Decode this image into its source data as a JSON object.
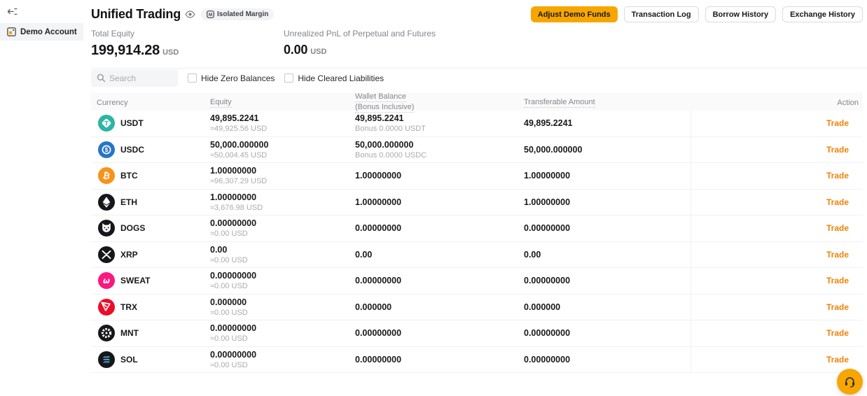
{
  "colors": {
    "brand_orange": "#f7a600",
    "trade_link": "#ee8208",
    "annotation_red": "#f5222d"
  },
  "sidebar": {
    "collapse_icon": "collapse-sidebar-icon",
    "items": [
      {
        "label": "Demo Account",
        "icon": "demo-account-icon",
        "selected": true
      }
    ]
  },
  "header": {
    "title": "Unified Trading",
    "title_icon": "eye-icon",
    "badge": {
      "icon": "margin-mode-icon",
      "label": "Isolated Margin"
    },
    "buttons": {
      "primary": {
        "label": "Adjust Demo Funds",
        "annotated": true
      },
      "secondary": [
        "Transaction Log",
        "Borrow History",
        "Exchange History"
      ]
    }
  },
  "stats": [
    {
      "label": "Total Equity",
      "value": "199,914.28",
      "unit": "USD"
    },
    {
      "label": "Unrealized PnL of Perpetual and Futures",
      "value": "0.00",
      "unit": "USD"
    }
  ],
  "filters": {
    "search_placeholder": "Search",
    "checkboxes": [
      {
        "label": "Hide Zero Balances",
        "checked": false
      },
      {
        "label": "Hide Cleared Liabilities",
        "checked": false
      }
    ]
  },
  "table": {
    "columns": [
      {
        "label": "Currency",
        "underlined": false
      },
      {
        "label": "Equity",
        "underlined": true
      },
      {
        "label": "Wallet Balance",
        "sublabel": "(Bonus Inclusive)",
        "underlined": true
      },
      {
        "label": "Transferable Amount",
        "underlined": true
      },
      {
        "label": "Action",
        "underlined": false
      }
    ],
    "trade_label": "Trade",
    "rows": [
      {
        "symbol": "USDT",
        "icon": "usdt-icon",
        "icon_bg": "#2ab5a5",
        "equity": "49,895.2241",
        "equity_usd": "≈49,925.56 USD",
        "wallet": "49,895.2241",
        "wallet_bonus": "Bonus 0.0000 USDT",
        "transferable": "49,895.2241"
      },
      {
        "symbol": "USDC",
        "icon": "usdc-icon",
        "icon_bg": "#2775ca",
        "equity": "50,000.000000",
        "equity_usd": "≈50,004.45 USD",
        "wallet": "50,000.000000",
        "wallet_bonus": "Bonus 0.0000 USDC",
        "transferable": "50,000.000000"
      },
      {
        "symbol": "BTC",
        "icon": "btc-icon",
        "icon_bg": "#f7931a",
        "equity": "1.00000000",
        "equity_usd": "≈96,307.29 USD",
        "wallet": "1.00000000",
        "transferable": "1.00000000"
      },
      {
        "symbol": "ETH",
        "icon": "eth-icon",
        "icon_bg": "#16171a",
        "equity": "1.00000000",
        "equity_usd": "≈3,676.98 USD",
        "wallet": "1.00000000",
        "transferable": "1.00000000"
      },
      {
        "symbol": "DOGS",
        "icon": "dogs-icon",
        "icon_bg": "#16171a",
        "equity": "0.00000000",
        "equity_usd": "≈0.00 USD",
        "wallet": "0.00000000",
        "transferable": "0.00000000"
      },
      {
        "symbol": "XRP",
        "icon": "xrp-icon",
        "icon_bg": "#16171a",
        "equity": "0.00",
        "equity_usd": "≈0.00 USD",
        "wallet": "0.00",
        "transferable": "0.00"
      },
      {
        "symbol": "SWEAT",
        "icon": "sweat-icon",
        "icon_bg": "#f9197f",
        "equity": "0.00000000",
        "equity_usd": "≈0.00 USD",
        "wallet": "0.00000000",
        "transferable": "0.00000000"
      },
      {
        "symbol": "TRX",
        "icon": "trx-icon",
        "icon_bg": "#eb0c27",
        "equity": "0.000000",
        "equity_usd": "≈0.00 USD",
        "wallet": "0.000000",
        "transferable": "0.000000"
      },
      {
        "symbol": "MNT",
        "icon": "mnt-icon",
        "icon_bg": "#16171a",
        "equity": "0.00000000",
        "equity_usd": "≈0.00 USD",
        "wallet": "0.00000000",
        "transferable": "0.00000000"
      },
      {
        "symbol": "SOL",
        "icon": "sol-icon",
        "icon_bg": "#16171a",
        "equity": "0.00000000",
        "equity_usd": "≈0.00 USD",
        "wallet": "0.00000000",
        "transferable": "0.00000000"
      }
    ]
  },
  "floating_button": {
    "icon": "headset-icon"
  }
}
